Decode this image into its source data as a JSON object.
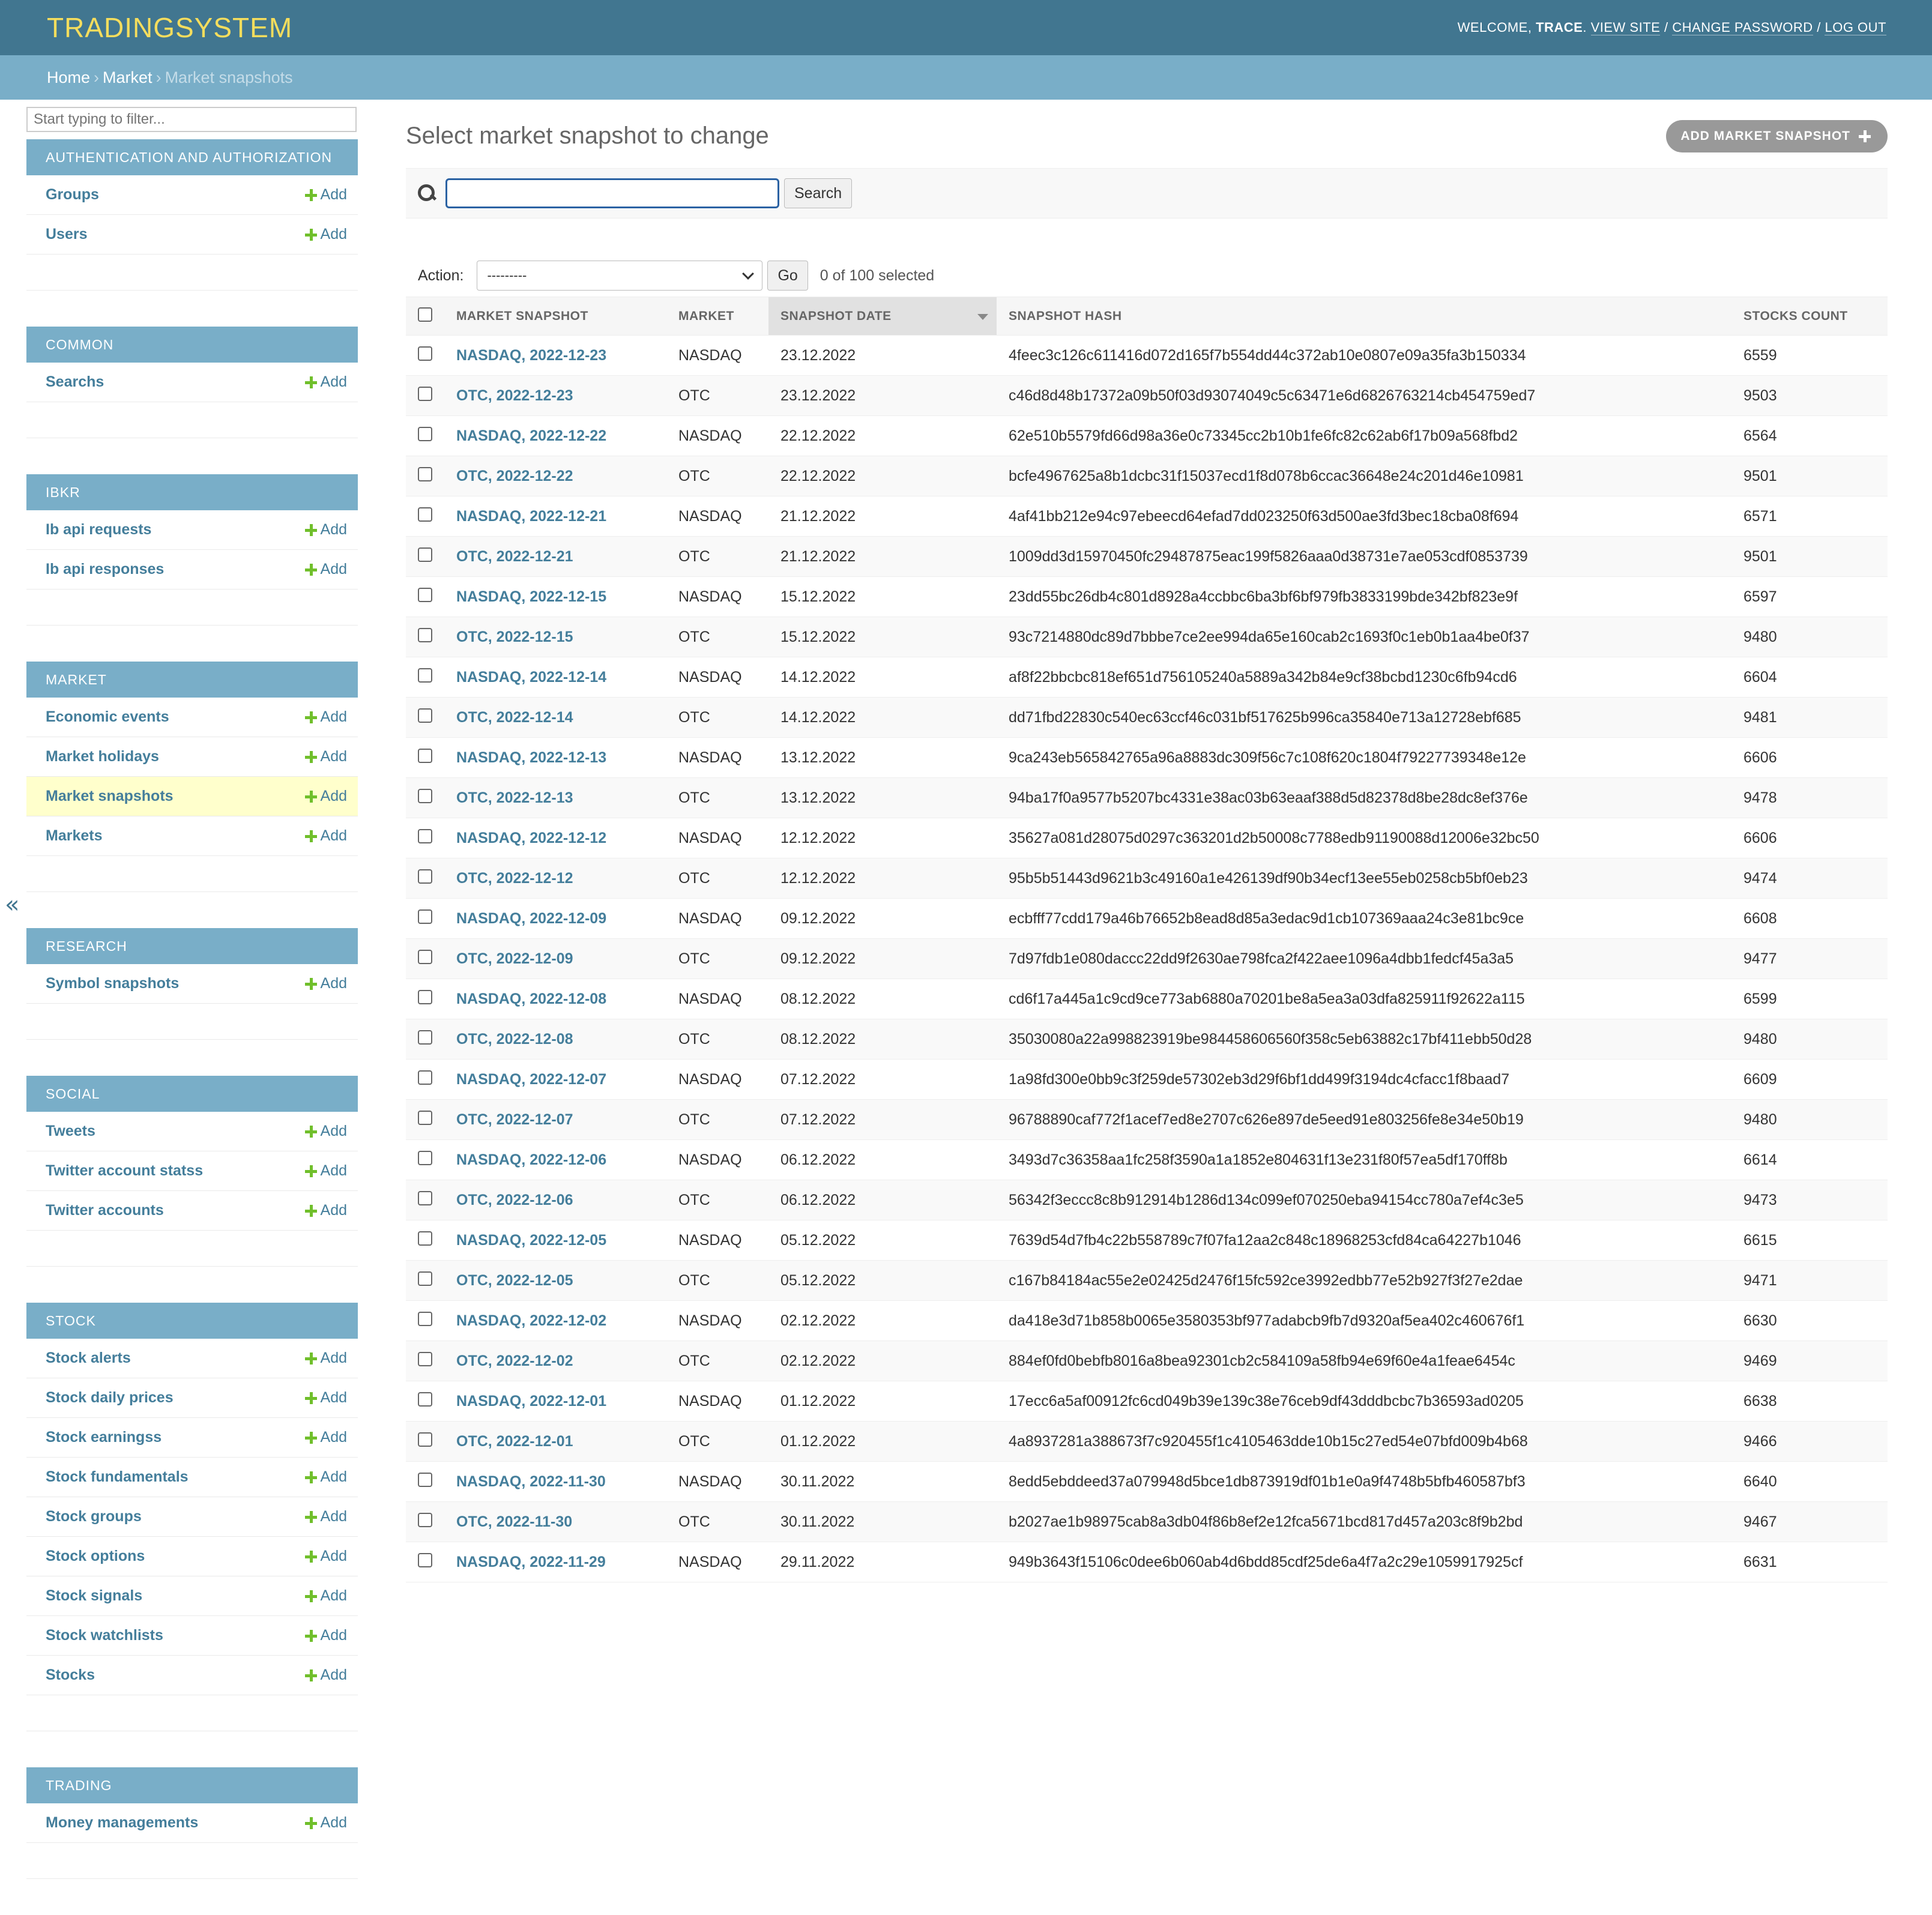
{
  "header": {
    "brand": "TRADINGSYSTEM",
    "welcome": "WELCOME, ",
    "user": "TRACE",
    "links": [
      "VIEW SITE",
      "CHANGE PASSWORD",
      "LOG OUT"
    ]
  },
  "breadcrumbs": {
    "home": "Home",
    "market": "Market",
    "current": "Market snapshots"
  },
  "sidebar": {
    "filter_placeholder": "Start typing to filter...",
    "add_label": "Add",
    "collapse_glyph": "«",
    "modules": [
      {
        "caption": "AUTHENTICATION AND AUTHORIZATION",
        "items": [
          "Groups",
          "Users"
        ]
      },
      {
        "caption": "COMMON",
        "items": [
          "Searchs"
        ]
      },
      {
        "caption": "IBKR",
        "items": [
          "Ib api requests",
          "Ib api responses"
        ]
      },
      {
        "caption": "MARKET",
        "items": [
          "Economic events",
          "Market holidays",
          "Market snapshots",
          "Markets"
        ]
      },
      {
        "caption": "RESEARCH",
        "items": [
          "Symbol snapshots"
        ]
      },
      {
        "caption": "SOCIAL",
        "items": [
          "Tweets",
          "Twitter account statss",
          "Twitter accounts"
        ]
      },
      {
        "caption": "STOCK",
        "items": [
          "Stock alerts",
          "Stock daily prices",
          "Stock earningss",
          "Stock fundamentals",
          "Stock groups",
          "Stock options",
          "Stock signals",
          "Stock watchlists",
          "Stocks"
        ]
      },
      {
        "caption": "TRADING",
        "items": [
          "Money managements"
        ]
      }
    ],
    "current_item": "Market snapshots"
  },
  "content": {
    "title": "Select market snapshot to change",
    "add_button": "ADD MARKET SNAPSHOT",
    "search_button": "Search",
    "action_label": "Action:",
    "action_selected": "---------",
    "go_button": "Go",
    "selection_counter": "0 of 100 selected"
  },
  "table": {
    "columns": [
      "MARKET SNAPSHOT",
      "MARKET",
      "SNAPSHOT DATE",
      "SNAPSHOT HASH",
      "STOCKS COUNT"
    ],
    "sorted_column": "SNAPSHOT DATE",
    "rows": [
      [
        "NASDAQ, 2022-12-23",
        "NASDAQ",
        "23.12.2022",
        "4feec3c126c611416d072d165f7b554dd44c372ab10e0807e09a35fa3b150334",
        "6559"
      ],
      [
        "OTC, 2022-12-23",
        "OTC",
        "23.12.2022",
        "c46d8d48b17372a09b50f03d93074049c5c63471e6d6826763214cb454759ed7",
        "9503"
      ],
      [
        "NASDAQ, 2022-12-22",
        "NASDAQ",
        "22.12.2022",
        "62e510b5579fd66d98a36e0c73345cc2b10b1fe6fc82c62ab6f17b09a568fbd2",
        "6564"
      ],
      [
        "OTC, 2022-12-22",
        "OTC",
        "22.12.2022",
        "bcfe4967625a8b1dcbc31f15037ecd1f8d078b6ccac36648e24c201d46e10981",
        "9501"
      ],
      [
        "NASDAQ, 2022-12-21",
        "NASDAQ",
        "21.12.2022",
        "4af41bb212e94c97ebeecd64efad7dd023250f63d500ae3fd3bec18cba08f694",
        "6571"
      ],
      [
        "OTC, 2022-12-21",
        "OTC",
        "21.12.2022",
        "1009dd3d15970450fc29487875eac199f5826aaa0d38731e7ae053cdf0853739",
        "9501"
      ],
      [
        "NASDAQ, 2022-12-15",
        "NASDAQ",
        "15.12.2022",
        "23dd55bc26db4c801d8928a4ccbbc6ba3bf6bf979fb3833199bde342bf823e9f",
        "6597"
      ],
      [
        "OTC, 2022-12-15",
        "OTC",
        "15.12.2022",
        "93c7214880dc89d7bbbe7ce2ee994da65e160cab2c1693f0c1eb0b1aa4be0f37",
        "9480"
      ],
      [
        "NASDAQ, 2022-12-14",
        "NASDAQ",
        "14.12.2022",
        "af8f22bbcbc818ef651d756105240a5889a342b84e9cf38bcbd1230c6fb94cd6",
        "6604"
      ],
      [
        "OTC, 2022-12-14",
        "OTC",
        "14.12.2022",
        "dd71fbd22830c540ec63ccf46c031bf517625b996ca35840e713a12728ebf685",
        "9481"
      ],
      [
        "NASDAQ, 2022-12-13",
        "NASDAQ",
        "13.12.2022",
        "9ca243eb565842765a96a8883dc309f56c7c108f620c1804f79227739348e12e",
        "6606"
      ],
      [
        "OTC, 2022-12-13",
        "OTC",
        "13.12.2022",
        "94ba17f0a9577b5207bc4331e38ac03b63eaaf388d5d82378d8be28dc8ef376e",
        "9478"
      ],
      [
        "NASDAQ, 2022-12-12",
        "NASDAQ",
        "12.12.2022",
        "35627a081d28075d0297c363201d2b50008c7788edb91190088d12006e32bc50",
        "6606"
      ],
      [
        "OTC, 2022-12-12",
        "OTC",
        "12.12.2022",
        "95b5b51443d9621b3c49160a1e426139df90b34ecf13ee55eb0258cb5bf0eb23",
        "9474"
      ],
      [
        "NASDAQ, 2022-12-09",
        "NASDAQ",
        "09.12.2022",
        "ecbfff77cdd179a46b76652b8ead8d85a3edac9d1cb107369aaa24c3e81bc9ce",
        "6608"
      ],
      [
        "OTC, 2022-12-09",
        "OTC",
        "09.12.2022",
        "7d97fdb1e080daccc22dd9f2630ae798fca2f422aee1096a4dbb1fedcf45a3a5",
        "9477"
      ],
      [
        "NASDAQ, 2022-12-08",
        "NASDAQ",
        "08.12.2022",
        "cd6f17a445a1c9cd9ce773ab6880a70201be8a5ea3a03dfa825911f92622a115",
        "6599"
      ],
      [
        "OTC, 2022-12-08",
        "OTC",
        "08.12.2022",
        "35030080a22a998823919be984458606560f358c5eb63882c17bf411ebb50d28",
        "9480"
      ],
      [
        "NASDAQ, 2022-12-07",
        "NASDAQ",
        "07.12.2022",
        "1a98fd300e0bb9c3f259de57302eb3d29f6bf1dd499f3194dc4cfacc1f8baad7",
        "6609"
      ],
      [
        "OTC, 2022-12-07",
        "OTC",
        "07.12.2022",
        "96788890caf772f1acef7ed8e2707c626e897de5eed91e803256fe8e34e50b19",
        "9480"
      ],
      [
        "NASDAQ, 2022-12-06",
        "NASDAQ",
        "06.12.2022",
        "3493d7c36358aa1fc258f3590a1a1852e804631f13e231f80f57ea5df170ff8b",
        "6614"
      ],
      [
        "OTC, 2022-12-06",
        "OTC",
        "06.12.2022",
        "56342f3eccc8c8b912914b1286d134c099ef070250eba94154cc780a7ef4c3e5",
        "9473"
      ],
      [
        "NASDAQ, 2022-12-05",
        "NASDAQ",
        "05.12.2022",
        "7639d54d7fb4c22b558789c7f07fa12aa2c848c18968253cfd84ca64227b1046",
        "6615"
      ],
      [
        "OTC, 2022-12-05",
        "OTC",
        "05.12.2022",
        "c167b84184ac55e2e02425d2476f15fc592ce3992edbb77e52b927f3f27e2dae",
        "9471"
      ],
      [
        "NASDAQ, 2022-12-02",
        "NASDAQ",
        "02.12.2022",
        "da418e3d71b858b0065e3580353bf977adabcb9fb7d9320af5ea402c460676f1",
        "6630"
      ],
      [
        "OTC, 2022-12-02",
        "OTC",
        "02.12.2022",
        "884ef0fd0bebfb8016a8bea92301cb2c584109a58fb94e69f60e4a1feae6454c",
        "9469"
      ],
      [
        "NASDAQ, 2022-12-01",
        "NASDAQ",
        "01.12.2022",
        "17ecc6a5af00912fc6cd049b39e139c38e76ceb9df43dddbcbc7b36593ad0205",
        "6638"
      ],
      [
        "OTC, 2022-12-01",
        "OTC",
        "01.12.2022",
        "4a8937281a388673f7c920455f1c4105463dde10b15c27ed54e07bfd009b4b68",
        "9466"
      ],
      [
        "NASDAQ, 2022-11-30",
        "NASDAQ",
        "30.11.2022",
        "8edd5ebddeed37a079948d5bce1db873919df01b1e0a9f4748b5bfb460587bf3",
        "6640"
      ],
      [
        "OTC, 2022-11-30",
        "OTC",
        "30.11.2022",
        "b2027ae1b98975cab8a3db04f86b8ef2e12fca5671bcd817d457a203c8f9b2bd",
        "9467"
      ],
      [
        "NASDAQ, 2022-11-29",
        "NASDAQ",
        "29.11.2022",
        "949b3643f15106c0dee6b060ab4d6bdd85cdf25de6a4f7a2c29e1059917925cf",
        "6631"
      ]
    ]
  }
}
